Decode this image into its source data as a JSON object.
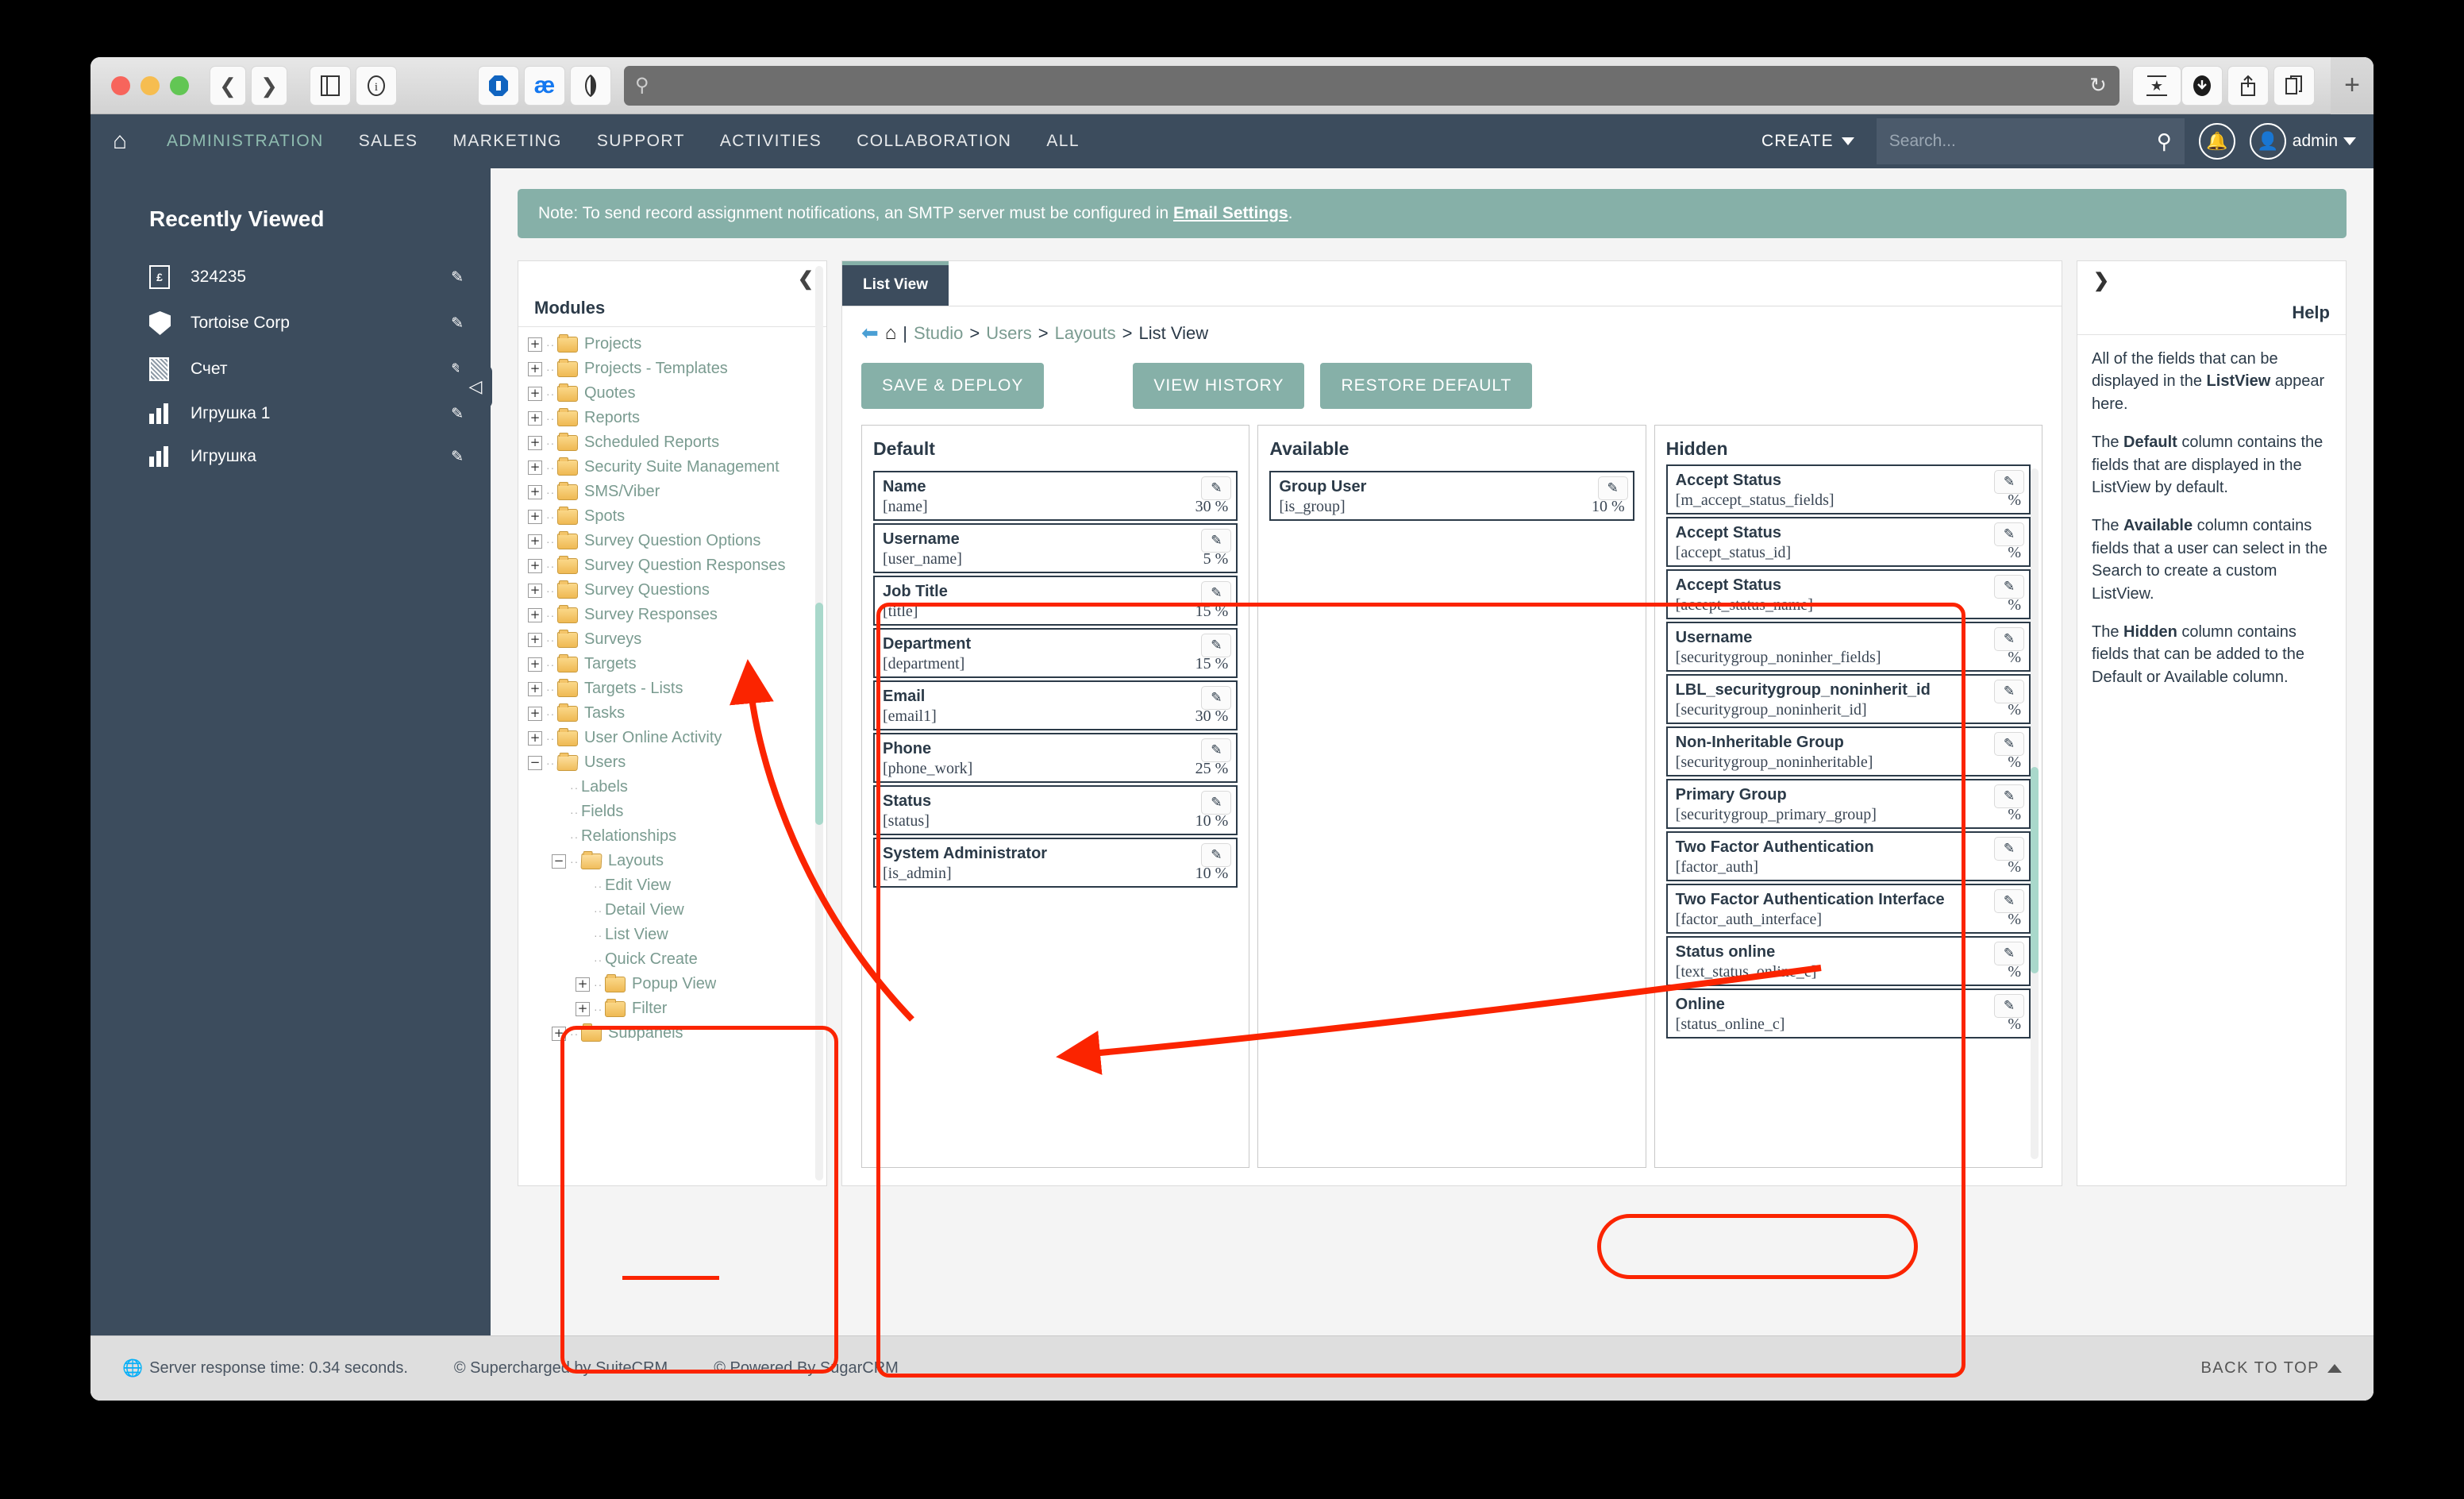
{
  "browser": {
    "toolbar_icons": [
      "back-icon",
      "forward-icon",
      "sidebar-icon",
      "info-icon",
      "adblock-icon",
      "ae-icon",
      "contrast-icon"
    ],
    "url_value": "",
    "url_placeholder": "",
    "right_icons": [
      "download-icon",
      "share-icon",
      "tabs-icon",
      "new-tab-icon"
    ]
  },
  "topnav": {
    "home_icon": "home-icon",
    "items": [
      {
        "label": "ADMINISTRATION",
        "active": true
      },
      {
        "label": "SALES",
        "active": false
      },
      {
        "label": "MARKETING",
        "active": false
      },
      {
        "label": "SUPPORT",
        "active": false
      },
      {
        "label": "ACTIVITIES",
        "active": false
      },
      {
        "label": "COLLABORATION",
        "active": false
      },
      {
        "label": "ALL",
        "active": false
      }
    ],
    "create_label": "CREATE",
    "search_placeholder": "Search...",
    "search_value": "",
    "user_label": "admin",
    "accent_color": "#8fbcb0",
    "bar_color": "#3c4c5d"
  },
  "sidebar": {
    "title": "Recently Viewed",
    "items": [
      {
        "label": "324235",
        "icon": "currency-document-icon"
      },
      {
        "label": "Tortoise Corp",
        "icon": "shield-icon"
      },
      {
        "label": "Счет",
        "icon": "document-icon"
      },
      {
        "label": "Игрушка 1",
        "icon": "bar-chart-icon"
      },
      {
        "label": "Игрушка",
        "icon": "bar-chart-icon"
      }
    ]
  },
  "note": {
    "text_before": "Note: To send record assignment notifications, an SMTP server must be configured in ",
    "link": "Email Settings",
    "text_after": ".",
    "color": "#86b0a8"
  },
  "modules": {
    "title": "Modules",
    "collapse_icon": "chevron-left-icon",
    "tree": [
      {
        "label": "Projects",
        "depth": 0,
        "toggle": "plus",
        "folder": "closed"
      },
      {
        "label": "Projects - Templates",
        "depth": 0,
        "toggle": "plus",
        "folder": "closed"
      },
      {
        "label": "Quotes",
        "depth": 0,
        "toggle": "plus",
        "folder": "closed"
      },
      {
        "label": "Reports",
        "depth": 0,
        "toggle": "plus",
        "folder": "closed"
      },
      {
        "label": "Scheduled Reports",
        "depth": 0,
        "toggle": "plus",
        "folder": "closed"
      },
      {
        "label": "Security Suite Management",
        "depth": 0,
        "toggle": "plus",
        "folder": "closed"
      },
      {
        "label": "SMS/Viber",
        "depth": 0,
        "toggle": "plus",
        "folder": "closed"
      },
      {
        "label": "Spots",
        "depth": 0,
        "toggle": "plus",
        "folder": "closed"
      },
      {
        "label": "Survey Question Options",
        "depth": 0,
        "toggle": "plus",
        "folder": "closed"
      },
      {
        "label": "Survey Question Responses",
        "depth": 0,
        "toggle": "plus",
        "folder": "closed"
      },
      {
        "label": "Survey Questions",
        "depth": 0,
        "toggle": "plus",
        "folder": "closed"
      },
      {
        "label": "Survey Responses",
        "depth": 0,
        "toggle": "plus",
        "folder": "closed"
      },
      {
        "label": "Surveys",
        "depth": 0,
        "toggle": "plus",
        "folder": "closed"
      },
      {
        "label": "Targets",
        "depth": 0,
        "toggle": "plus",
        "folder": "closed"
      },
      {
        "label": "Targets - Lists",
        "depth": 0,
        "toggle": "plus",
        "folder": "closed"
      },
      {
        "label": "Tasks",
        "depth": 0,
        "toggle": "plus",
        "folder": "closed"
      },
      {
        "label": "User Online Activity",
        "depth": 0,
        "toggle": "plus",
        "folder": "closed"
      },
      {
        "label": "Users",
        "depth": 0,
        "toggle": "minus",
        "folder": "open"
      },
      {
        "label": "Labels",
        "depth": 1,
        "toggle": "none",
        "folder": "none"
      },
      {
        "label": "Fields",
        "depth": 1,
        "toggle": "none",
        "folder": "none"
      },
      {
        "label": "Relationships",
        "depth": 1,
        "toggle": "none",
        "folder": "none"
      },
      {
        "label": "Layouts",
        "depth": 1,
        "toggle": "minus",
        "folder": "open"
      },
      {
        "label": "Edit View",
        "depth": 2,
        "toggle": "none",
        "folder": "none"
      },
      {
        "label": "Detail View",
        "depth": 2,
        "toggle": "none",
        "folder": "none"
      },
      {
        "label": "List View",
        "depth": 2,
        "toggle": "none",
        "folder": "none"
      },
      {
        "label": "Quick Create",
        "depth": 2,
        "toggle": "none",
        "folder": "none"
      },
      {
        "label": "Popup View",
        "depth": 2,
        "toggle": "plus",
        "folder": "closed"
      },
      {
        "label": "Filter",
        "depth": 2,
        "toggle": "plus",
        "folder": "closed"
      },
      {
        "label": "Subpanels",
        "depth": 1,
        "toggle": "plus",
        "folder": "closed"
      }
    ]
  },
  "studio": {
    "tab_label": "List View",
    "breadcrumb": {
      "back_icon": "back-arrow-icon",
      "home_icon": "home-icon",
      "crumbs": [
        "Studio",
        "Users",
        "Layouts",
        "List View"
      ]
    },
    "buttons": {
      "save_deploy": "SAVE & DEPLOY",
      "view_history": "VIEW HISTORY",
      "restore_default": "RESTORE DEFAULT"
    },
    "columns": [
      {
        "title": "Default",
        "fields": [
          {
            "name": "Name",
            "key": "[name]",
            "pct": "30 %"
          },
          {
            "name": "Username",
            "key": "[user_name]",
            "pct": "5 %"
          },
          {
            "name": "Job Title",
            "key": "[title]",
            "pct": "15 %"
          },
          {
            "name": "Department",
            "key": "[department]",
            "pct": "15 %"
          },
          {
            "name": "Email",
            "key": "[email1]",
            "pct": "30 %"
          },
          {
            "name": "Phone",
            "key": "[phone_work]",
            "pct": "25 %"
          },
          {
            "name": "Status",
            "key": "[status]",
            "pct": "10 %"
          },
          {
            "name": "System Administrator",
            "key": "[is_admin]",
            "pct": "10 %"
          }
        ]
      },
      {
        "title": "Available",
        "fields": [
          {
            "name": "Group User",
            "key": "[is_group]",
            "pct": "10 %"
          }
        ]
      },
      {
        "title": "Hidden",
        "fields": [
          {
            "name": "Accept Status",
            "key": "[m_accept_status_fields]",
            "pct": "%"
          },
          {
            "name": "Accept Status",
            "key": "[accept_status_id]",
            "pct": "%"
          },
          {
            "name": "Accept Status",
            "key": "[accept_status_name]",
            "pct": "%"
          },
          {
            "name": "Username",
            "key": "[securitygroup_noninher_fields]",
            "pct": "%"
          },
          {
            "name": "LBL_securitygroup_noninherit_id",
            "key": "[securitygroup_noninherit_id]",
            "pct": "%"
          },
          {
            "name": "Non-Inheritable Group",
            "key": "[securitygroup_noninheritable]",
            "pct": "%"
          },
          {
            "name": "Primary Group",
            "key": "[securitygroup_primary_group]",
            "pct": "%"
          },
          {
            "name": "Two Factor Authentication",
            "key": "[factor_auth]",
            "pct": "%"
          },
          {
            "name": "Two Factor Authentication Interface",
            "key": "[factor_auth_interface]",
            "pct": "%"
          },
          {
            "name": "Status online",
            "key": "[text_status_online_c]",
            "pct": "%"
          },
          {
            "name": "Online",
            "key": "[status_online_c]",
            "pct": "%"
          }
        ]
      }
    ]
  },
  "help": {
    "expand_icon": "chevron-right-icon",
    "title": "Help",
    "paragraphs": [
      "All of the fields that can be displayed in the ListView appear here.",
      "The Default column contains the fields that are displayed in the ListView by default.",
      "The Available column contains fields that a user can select in the Search to create a custom ListView.",
      "The Hidden column contains fields that can be added to the Default or Available column."
    ]
  },
  "footer": {
    "server_time": "Server response time: 0.34 seconds.",
    "supercharged": "© Supercharged by SuiteCRM",
    "powered": "© Powered By SugarCRM",
    "back_to_top": "BACK TO TOP"
  },
  "annotations": {
    "highlight_color": "#fb2400",
    "shapes": [
      "columns-outline",
      "tree-outline",
      "status-online-outline",
      "list-view-underline",
      "arrow-to-tree",
      "arrow-to-default"
    ]
  }
}
